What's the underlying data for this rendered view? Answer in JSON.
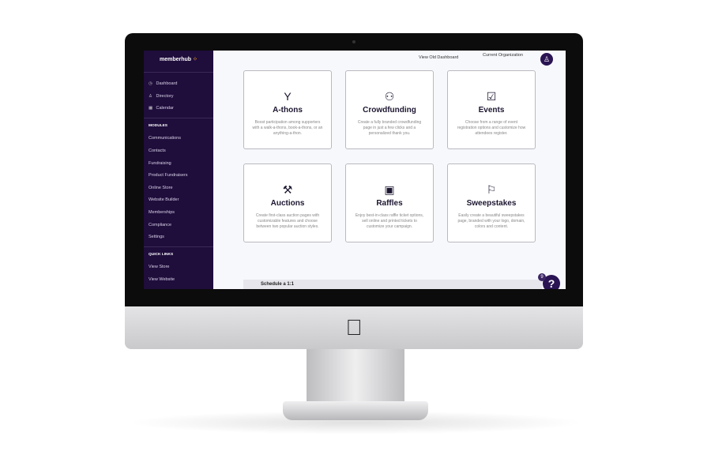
{
  "brand": {
    "name": "memberhub",
    "accent": "#f5a623",
    "sidebar_bg": "#1f0d3c"
  },
  "sidebar": {
    "main": [
      {
        "label": "Dashboard",
        "icon": "dashboard-icon"
      },
      {
        "label": "Directory",
        "icon": "users-icon"
      },
      {
        "label": "Calendar",
        "icon": "calendar-icon"
      }
    ],
    "modules_heading": "MODULES",
    "modules": [
      "Communications",
      "Contacts",
      "Fundraising",
      "Product Fundraisers",
      "Online Store",
      "Website Builder",
      "Memberships",
      "Compliance",
      "Settings"
    ],
    "quick_heading": "QUICK LINKS",
    "quick": [
      "View Store",
      "View Website"
    ]
  },
  "topbar": {
    "old_dashboard": "View Old Dashboard",
    "org": "Current Organization"
  },
  "cards": [
    {
      "title": "A-thons",
      "icon": "athlete-icon",
      "desc": "Boost participation among supporters with a walk-a-thons, book-a-thons, or an anything-a-thon."
    },
    {
      "title": "Crowdfunding",
      "icon": "crowd-icon",
      "desc": "Create a fully branded crowdfunding page in just a few clicks and a personalized thank you."
    },
    {
      "title": "Events",
      "icon": "calendar-check-icon",
      "desc": "Choose from a range of event registration options and customize how attendees register."
    },
    {
      "title": "Auctions",
      "icon": "gavel-icon",
      "desc": "Create first-class auction pages with customizable features and choose between two popular auction styles."
    },
    {
      "title": "Raffles",
      "icon": "ticket-icon",
      "desc": "Enjoy best-in-class raffle ticket options, sell online and printed tickets to customize your campaign."
    },
    {
      "title": "Sweepstakes",
      "icon": "flag-icon",
      "desc": "Easily create a beautiful sweepstakes page, branded with your logo, domain, colors and content."
    }
  ],
  "schedule": "Schedule a 1:1",
  "help": {
    "badge": "9",
    "label": "?"
  }
}
